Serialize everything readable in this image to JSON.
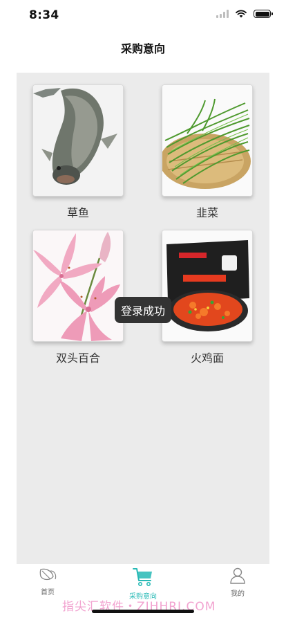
{
  "status_bar": {
    "time": "8:34"
  },
  "nav": {
    "title": "采购意向"
  },
  "products": [
    {
      "name": "草鱼",
      "image": "grass-carp-photo"
    },
    {
      "name": "韭菜",
      "image": "chives-photo"
    },
    {
      "name": "双头百合",
      "image": "lily-photo"
    },
    {
      "name": "火鸡面",
      "image": "turkey-noodles-photo"
    }
  ],
  "toast": {
    "text": "登录成功"
  },
  "tab_bar": {
    "tabs": [
      {
        "label": "首页",
        "icon": "leaf-icon"
      },
      {
        "label": "采购意向",
        "icon": "cart-icon",
        "active": true
      },
      {
        "label": "我的",
        "icon": "person-icon"
      }
    ],
    "active_color": "#26b9b5"
  },
  "watermark": {
    "text": "指尖汇软件・ZJHHRJ.COM"
  }
}
